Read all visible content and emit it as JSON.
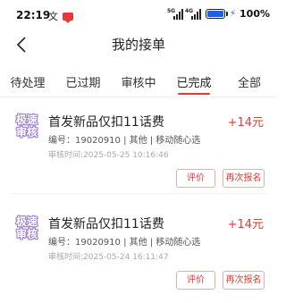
{
  "status_bar": {
    "time": "22:19",
    "left_glyph": "文",
    "network_1": "5G",
    "network_2": "4G",
    "battery_text": "100%",
    "battery_level": 1.0,
    "battery_color": "#1e63d8"
  },
  "nav": {
    "title": "我的接单",
    "back_icon": "chevron-left-icon"
  },
  "tabs": [
    {
      "label": "待处理",
      "active": false
    },
    {
      "label": "已过期",
      "active": false
    },
    {
      "label": "审核中",
      "active": false
    },
    {
      "label": "已完成",
      "active": true
    },
    {
      "label": "全部",
      "active": false
    }
  ],
  "orders": [
    {
      "badge_line1": "极速",
      "badge_line2": "审核",
      "title": "首发新品仅扣11话费",
      "price": "+14元",
      "meta": "编号：19020910 | 其他 | 移动随心选",
      "audit_time": "审核时间:2025-05-25 10:16:46",
      "rate_label": "评价",
      "reapply_label": "再次报名"
    },
    {
      "badge_line1": "极速",
      "badge_line2": "审核",
      "title": "首发新品仅扣11话费",
      "price": "+14元",
      "meta": "编号：19020910 | 其他 | 移动随心选",
      "audit_time": "审核时间:2025-05-24 16:11:47",
      "rate_label": "评价",
      "reapply_label": "再次报名"
    }
  ],
  "colors": {
    "accent": "#e53935",
    "badge": "#9b7bd8"
  }
}
